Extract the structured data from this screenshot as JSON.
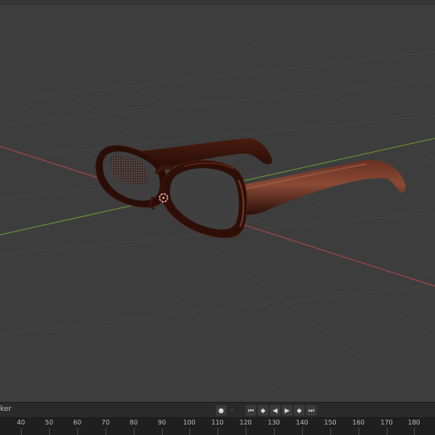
{
  "viewport": {
    "object": "glasses",
    "axis_colors": {
      "x": "#c04a4a",
      "y": "#6a9a32"
    },
    "background": "#3d3d3d",
    "frame_color": "#3a160c"
  },
  "timeline": {
    "menu_label": "ker",
    "controls": [
      {
        "name": "record-icon",
        "glyph": "●"
      },
      {
        "name": "auto-key-icon",
        "glyph": "·"
      },
      {
        "name": "jump-start-icon",
        "glyph": "⏮"
      },
      {
        "name": "prev-keyframe-icon",
        "glyph": "◆"
      },
      {
        "name": "play-reverse-icon",
        "glyph": "◀"
      },
      {
        "name": "play-icon",
        "glyph": "▶"
      },
      {
        "name": "next-keyframe-icon",
        "glyph": "◆"
      },
      {
        "name": "jump-end-icon",
        "glyph": "⏭"
      }
    ],
    "ruler_ticks": [
      "40",
      "50",
      "60",
      "70",
      "80",
      "90",
      "100",
      "110",
      "120",
      "130",
      "140",
      "150",
      "160",
      "170",
      "180"
    ]
  }
}
